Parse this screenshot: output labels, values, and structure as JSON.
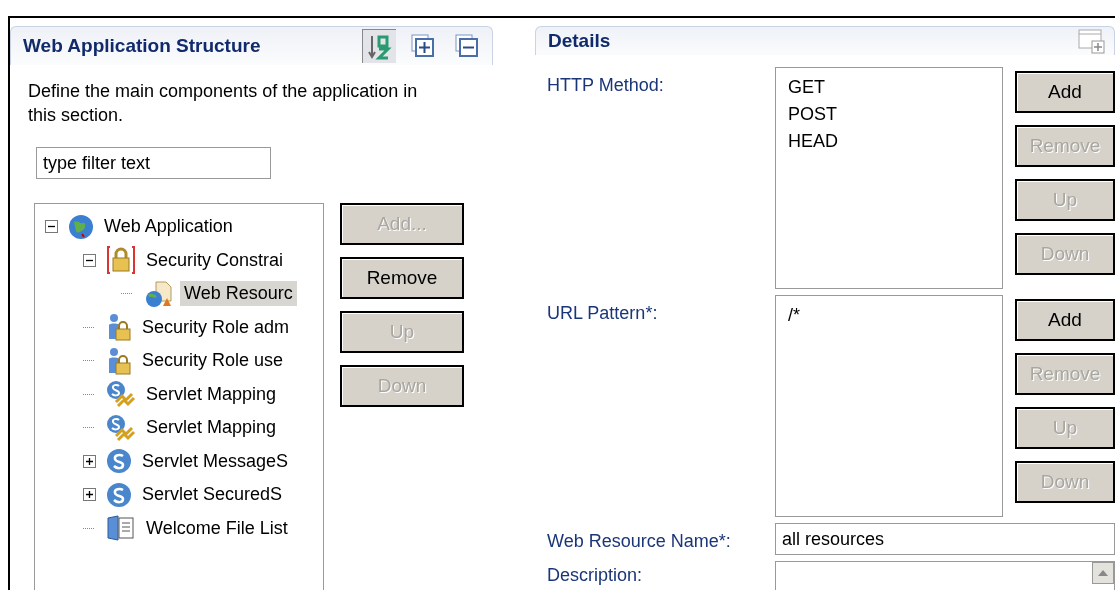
{
  "structure_section": {
    "title": "Web Application Structure",
    "description": "Define the main components of the application in this section.",
    "filter": {
      "placeholder": "type filter text"
    },
    "tree": [
      {
        "label": "Web Application",
        "kind": "globe",
        "expanded": true,
        "selected": false,
        "children": [
          {
            "label": "Security Constrai",
            "kind": "lock",
            "expanded": true,
            "selected": false,
            "children": [
              {
                "label": "Web Resourc",
                "kind": "resource",
                "selected": true
              }
            ]
          },
          {
            "label": "Security Role adm",
            "kind": "role",
            "selected": false
          },
          {
            "label": "Security Role use",
            "kind": "role",
            "selected": false
          },
          {
            "label": "Servlet Mapping",
            "kind": "mapping",
            "selected": false
          },
          {
            "label": "Servlet Mapping",
            "kind": "mapping",
            "selected": false
          },
          {
            "label": "Servlet MessageS",
            "kind": "servlet",
            "expanded": false,
            "selected": false
          },
          {
            "label": "Servlet SecuredS",
            "kind": "servlet",
            "expanded": false,
            "selected": false
          },
          {
            "label": "Welcome File List",
            "kind": "welcome",
            "selected": false
          }
        ]
      }
    ],
    "buttons": [
      {
        "label": "Add...",
        "disabled": true
      },
      {
        "label": "Remove",
        "disabled": false
      },
      {
        "label": "Up",
        "disabled": true
      },
      {
        "label": "Down",
        "disabled": true
      }
    ]
  },
  "details_section": {
    "title": "Details",
    "http_method": {
      "label": "HTTP Method:",
      "items": [
        "GET",
        "POST",
        "HEAD"
      ],
      "buttons": [
        {
          "label": "Add",
          "disabled": false
        },
        {
          "label": "Remove",
          "disabled": true
        },
        {
          "label": "Up",
          "disabled": true
        },
        {
          "label": "Down",
          "disabled": true
        }
      ]
    },
    "url_pattern": {
      "label": "URL Pattern*:",
      "items": [
        "/*"
      ],
      "buttons": [
        {
          "label": "Add",
          "disabled": false
        },
        {
          "label": "Remove",
          "disabled": true
        },
        {
          "label": "Up",
          "disabled": true
        },
        {
          "label": "Down",
          "disabled": true
        }
      ]
    },
    "web_resource_name": {
      "label": "Web Resource Name*:",
      "value": "all resources"
    },
    "description": {
      "label": "Description:"
    }
  }
}
